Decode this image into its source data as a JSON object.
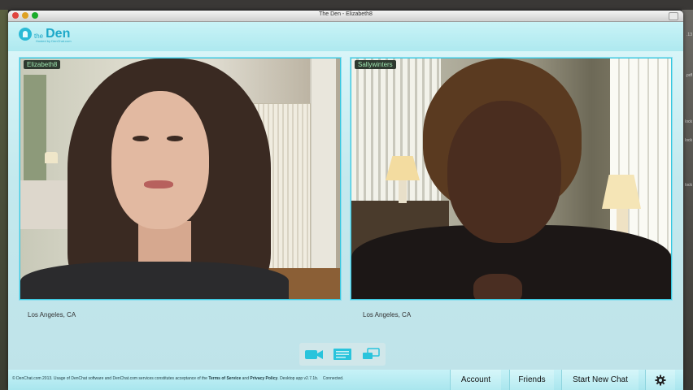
{
  "window": {
    "title": "The Den - Elizabeth8"
  },
  "app": {
    "logo_the": "the",
    "logo_den": "Den",
    "logo_sub": "Hosted by DenChat.com"
  },
  "videos": [
    {
      "username": "Elizabeth8",
      "location": "Los Angeles, CA"
    },
    {
      "username": "Sallywinters",
      "location": "Los Angeles, CA"
    }
  ],
  "controls": [
    {
      "icon": "video-camera-icon",
      "color": "#29c4dc"
    },
    {
      "icon": "chat-icon",
      "color": "#29c4dc"
    },
    {
      "icon": "share-screen-icon",
      "color": "#29c4dc"
    }
  ],
  "footer": {
    "copyright_pre": "© DenChat.com 2013. Usage of DenChat software and DenChat.com services constitutes acceptance of the ",
    "terms": "Terms of Service",
    "and": " and ",
    "privacy": "Privacy Policy",
    "app_version": ".  Desktop app v2.7.1b.",
    "status": "Connected.",
    "account_label": "Account",
    "friends_label": "Friends",
    "new_chat_label": "Start New Chat",
    "settings_icon": "gear-icon"
  },
  "desktop_side_text": [
    ".13",
    ".pdf",
    "lock",
    "lock",
    "lock"
  ]
}
